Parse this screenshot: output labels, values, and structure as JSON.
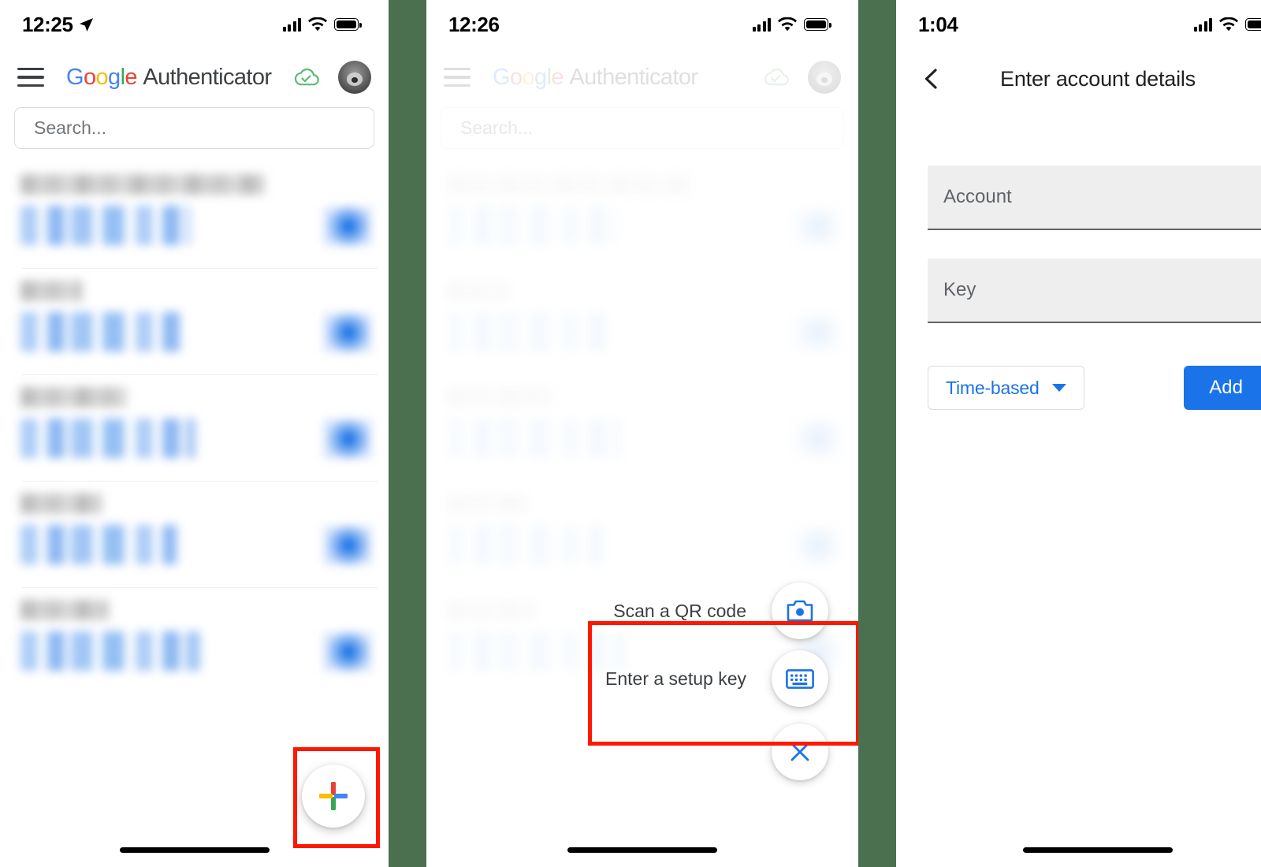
{
  "theme": {
    "gutter_color": "#4a7050",
    "google_blue": "#1a73e8",
    "annotation_red": "#FF1800",
    "field_bg": "#eeeeee"
  },
  "panel1": {
    "status": {
      "time": "12:25",
      "location_icon": "location-arrow-icon",
      "cellular_icon": "cellular-bars-icon",
      "wifi_icon": "wifi-icon",
      "battery_icon": "battery-icon"
    },
    "appbar": {
      "menu_icon": "hamburger-menu-icon",
      "brand_google": "Google",
      "brand_word": "Authenticator",
      "cloud_icon": "cloud-sync-check-icon",
      "avatar_icon": "user-avatar"
    },
    "search": {
      "placeholder": "Search..."
    },
    "accounts": [
      {
        "name_redacted": true,
        "code_redacted": true
      },
      {
        "name_redacted": true,
        "code_redacted": true
      },
      {
        "name_redacted": true,
        "code_redacted": true
      },
      {
        "name_redacted": true,
        "code_redacted": true
      },
      {
        "name_redacted": true,
        "code_redacted": true
      }
    ],
    "fab": {
      "icon": "google-plus-add-icon",
      "highlighted": true
    }
  },
  "panel2": {
    "status": {
      "time": "12:26"
    },
    "appbar": {
      "menu_icon": "hamburger-menu-icon",
      "brand_google": "Google",
      "brand_word": "Authenticator",
      "cloud_icon": "cloud-sync-check-icon",
      "avatar_icon": "user-avatar"
    },
    "search": {
      "placeholder": "Search..."
    },
    "sheet": {
      "highlighted": true,
      "options": [
        {
          "label": "Scan a QR code",
          "icon": "camera-icon"
        },
        {
          "label": "Enter a setup key",
          "icon": "keyboard-icon"
        }
      ],
      "close": {
        "icon": "close-x-icon"
      }
    }
  },
  "panel3": {
    "status": {
      "time": "1:04"
    },
    "topbar": {
      "back_icon": "back-chevron-icon",
      "title": "Enter account details"
    },
    "form": {
      "account_field": {
        "label": "Account",
        "value": ""
      },
      "key_field": {
        "label": "Key",
        "value": ""
      },
      "type_dropdown": {
        "value": "Time-based",
        "caret_icon": "chevron-down-icon"
      },
      "add_button": {
        "label": "Add"
      }
    }
  }
}
